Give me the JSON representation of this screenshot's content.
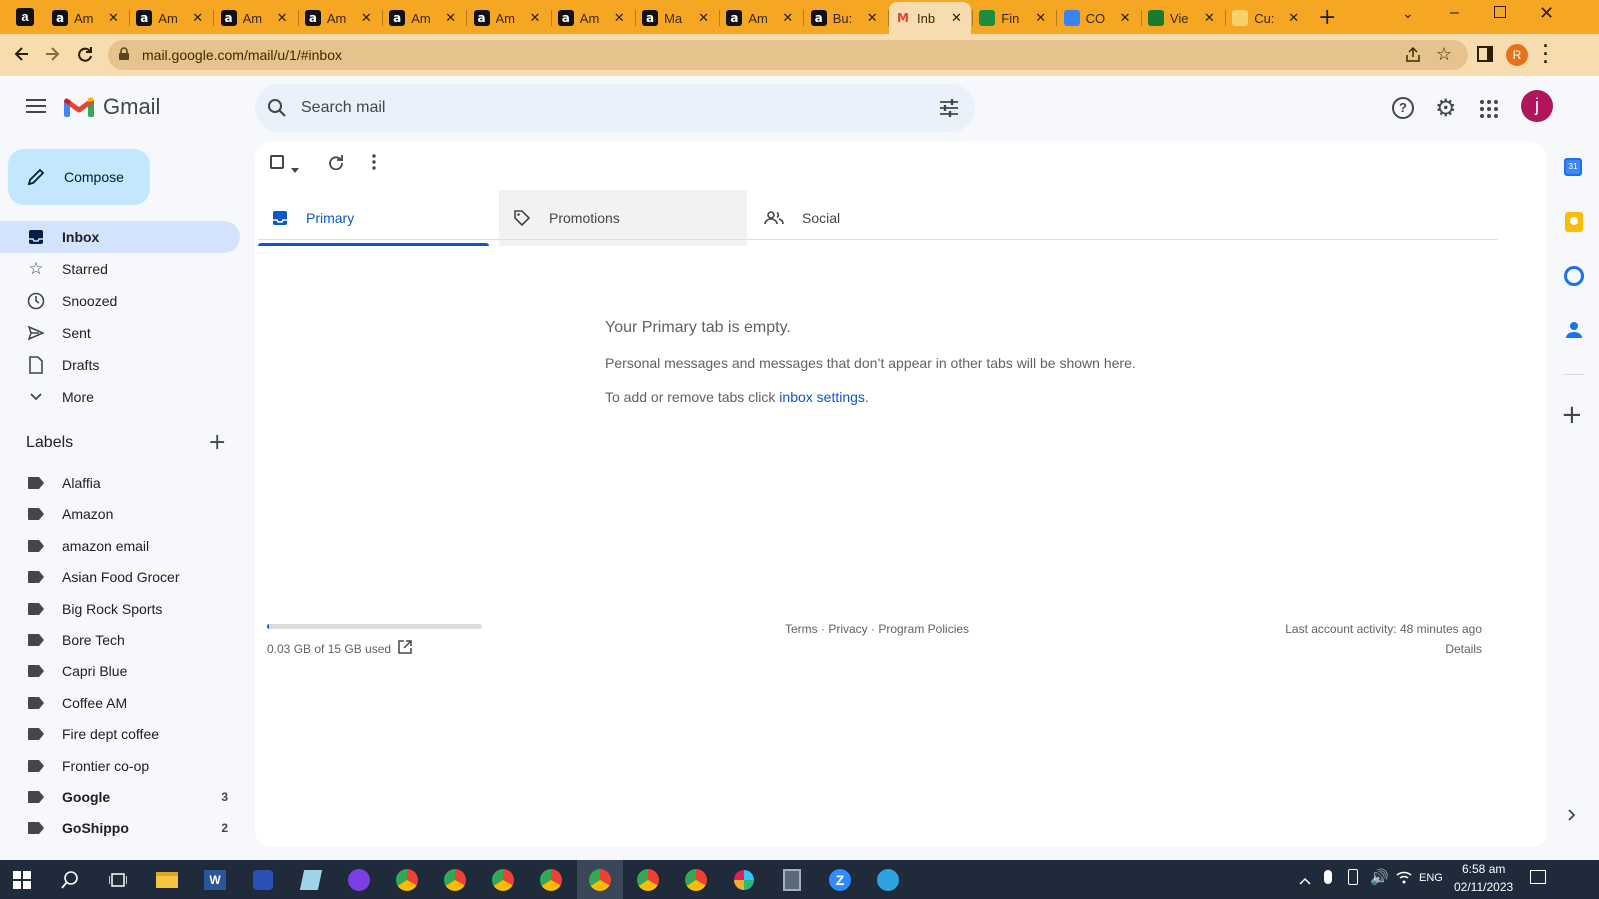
{
  "browser": {
    "tabs": [
      {
        "title": "Am"
      },
      {
        "title": "Am"
      },
      {
        "title": "Am"
      },
      {
        "title": "Am"
      },
      {
        "title": "Am"
      },
      {
        "title": "Am"
      },
      {
        "title": "Am"
      },
      {
        "title": "Ma"
      },
      {
        "title": "Am"
      },
      {
        "title": "Bu:"
      },
      {
        "title": "Inb"
      },
      {
        "title": "Fin"
      },
      {
        "title": "CO"
      },
      {
        "title": "Vie"
      },
      {
        "title": "Cu:"
      }
    ],
    "url": "mail.google.com/mail/u/1/#inbox",
    "profile_initial": "R"
  },
  "gmail": {
    "logo_text": "Gmail",
    "search_placeholder": "Search mail",
    "avatar_initial": "j",
    "compose_label": "Compose",
    "nav": [
      {
        "label": "Inbox"
      },
      {
        "label": "Starred"
      },
      {
        "label": "Snoozed"
      },
      {
        "label": "Sent"
      },
      {
        "label": "Drafts"
      },
      {
        "label": "More"
      }
    ],
    "labels_header": "Labels",
    "labels": [
      {
        "name": "Alaffia",
        "count": ""
      },
      {
        "name": "Amazon",
        "count": ""
      },
      {
        "name": "amazon email",
        "count": ""
      },
      {
        "name": "Asian Food Grocer",
        "count": ""
      },
      {
        "name": "Big Rock Sports",
        "count": ""
      },
      {
        "name": "Bore Tech",
        "count": ""
      },
      {
        "name": "Capri Blue",
        "count": ""
      },
      {
        "name": "Coffee AM",
        "count": ""
      },
      {
        "name": "Fire dept coffee",
        "count": ""
      },
      {
        "name": "Frontier co-op",
        "count": ""
      },
      {
        "name": "Google",
        "count": "3"
      },
      {
        "name": "GoShippo",
        "count": "2"
      }
    ],
    "inbox_tabs": [
      {
        "label": "Primary"
      },
      {
        "label": "Promotions"
      },
      {
        "label": "Social"
      }
    ],
    "empty_title": "Your Primary tab is empty.",
    "empty_line1": "Personal messages and messages that don’t appear in other tabs will be shown here.",
    "empty_line2_prefix": "To add or remove tabs click ",
    "empty_line2_link": "inbox settings",
    "empty_line2_suffix": ".",
    "storage_text": "0.03 GB of 15 GB used",
    "storage_fraction": 0.002,
    "footer_links": "Terms · Privacy · Program Policies",
    "last_activity": "Last account activity: 48 minutes ago",
    "details_link": "Details"
  },
  "taskbar": {
    "lang": "ENG",
    "time": "6:58 am",
    "date": "02/11/2023"
  },
  "colors": {
    "tabstrip": "#f5a623",
    "toolbar": "#f7dcb0",
    "accent_blue": "#0b57d0",
    "nav_active": "#d3e3fd",
    "compose_bg": "#c2e7ff"
  }
}
